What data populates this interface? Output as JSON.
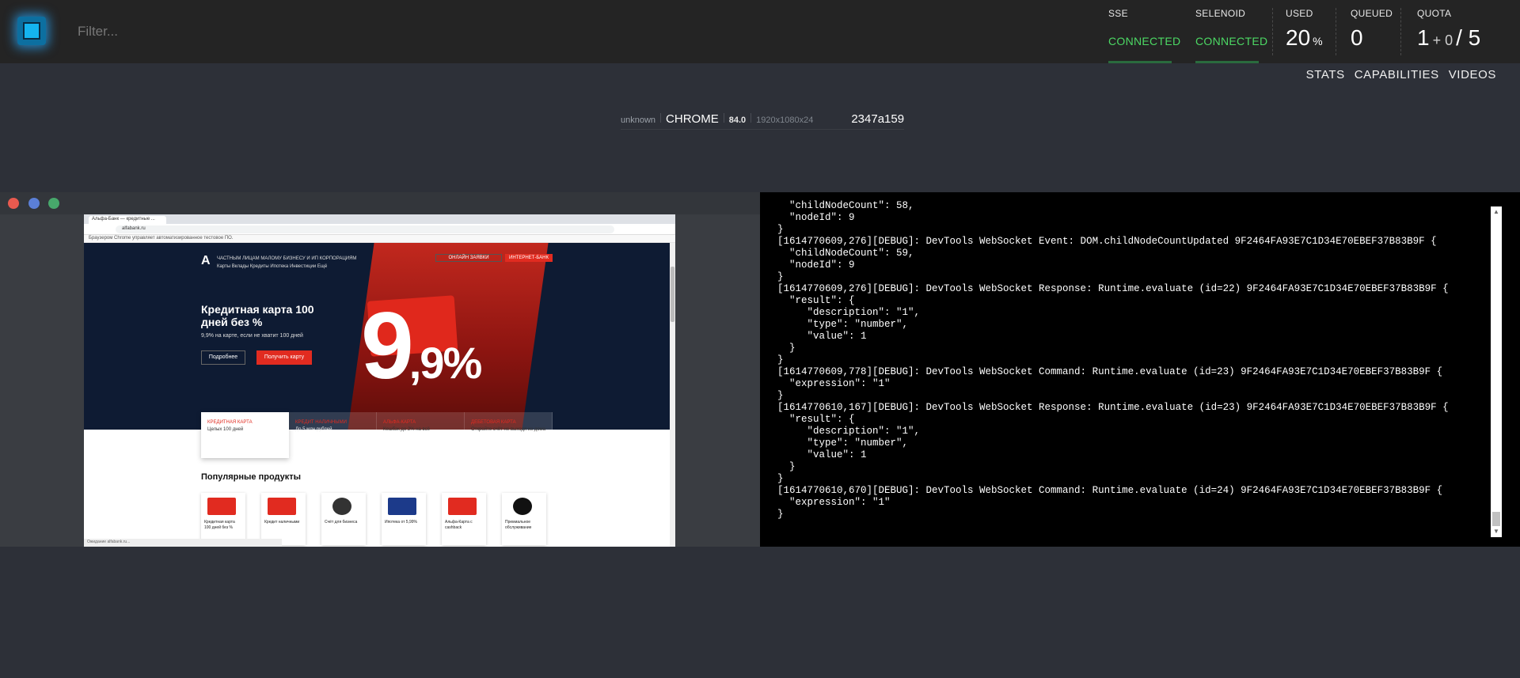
{
  "header": {
    "filter_placeholder": "Filter...",
    "stats": {
      "sse": {
        "label": "SSE",
        "status": "CONNECTED"
      },
      "selenoid": {
        "label": "SELENOID",
        "status": "CONNECTED"
      },
      "used": {
        "label": "USED",
        "value": "20",
        "unit": "%"
      },
      "queued": {
        "label": "QUEUED",
        "value": "0"
      },
      "quota": {
        "label": "QUOTA",
        "value_used": "1",
        "plus": "+ 0",
        "slash": "/",
        "value_total": "5"
      }
    },
    "colors": {
      "connected": "#4cd964",
      "accent": "#14b4f0"
    }
  },
  "nav": {
    "stats": "STATS",
    "capabilities": "CAPABILITIES",
    "videos": "VIDEOS"
  },
  "session": {
    "platform": "unknown",
    "browser": "CHROME",
    "version": "84.0",
    "resolution": "1920x1080x24",
    "id": "2347a159"
  },
  "vnc": {
    "window_dots": [
      "#e85a4f",
      "#5b7fd6",
      "#47a86b"
    ],
    "remote_page": {
      "tab_title": "Альфа-Банк — кредитные ...",
      "url": "alfabank.ru",
      "infobar": "Браузером Chrome управляет автоматизированное тестовое ПО.",
      "brand": "А",
      "menu_top": "ЧАСТНЫМ ЛИЦАМ   МАЛОМУ БИЗНЕСУ И ИП   КОРПОРАЦИЯМ",
      "menu_bottom": "Карты  Вклады  Кредиты  Ипотека  Инвестиции  Ещё",
      "btn_apply": "ОНЛАЙН ЗАЯВКИ",
      "btn_bank": "ИНТЕРНЕТ-БАНК",
      "hero_title": "Кредитная карта 100 дней без %",
      "hero_sub": "9,9% на карте, если не хватит 100 дней",
      "btn_more": "Подробнее",
      "btn_get": "Получить карту",
      "big_number": "9",
      "big_suffix": ",9%",
      "tiles": [
        {
          "title": "КРЕДИТНАЯ КАРТА",
          "text": "Целых 100 дней"
        },
        {
          "title": "КРЕДИТ НАЛИЧНЫМИ",
          "text": "До 5 млн рублей"
        },
        {
          "title": "АЛЬФА-КАРТА",
          "text": "Кешбэк до 2% на всё"
        },
        {
          "title": "ДЕБЕТОВАЯ КАРТА",
          "text": "Откройте счёт не выходя из дома"
        }
      ],
      "popular_title": "Популярные продукты",
      "products": [
        {
          "name": "Кредитная карта 100 дней без %",
          "color": "#e12b20"
        },
        {
          "name": "Кредит наличными",
          "color": "#e12b20"
        },
        {
          "name": "Счёт для бизнеса",
          "color": "#333333"
        },
        {
          "name": "Ипотека от 5,99%",
          "color": "#1c3a8a"
        },
        {
          "name": "Альфа-Карта с cashback",
          "color": "#e12b20"
        },
        {
          "name": "Премиальное обслуживание",
          "color": "#111111"
        }
      ],
      "statusbar": "Ожидание alfabank.ru..."
    }
  },
  "log": {
    "lines": [
      "  \"childNodeCount\": 58,",
      "  \"nodeId\": 9",
      "}",
      "[1614770609,276][DEBUG]: DevTools WebSocket Event: DOM.childNodeCountUpdated 9F2464FA93E7C1D34E70EBEF37B83B9F {",
      "  \"childNodeCount\": 59,",
      "  \"nodeId\": 9",
      "}",
      "[1614770609,276][DEBUG]: DevTools WebSocket Response: Runtime.evaluate (id=22) 9F2464FA93E7C1D34E70EBEF37B83B9F {",
      "  \"result\": {",
      "     \"description\": \"1\",",
      "     \"type\": \"number\",",
      "     \"value\": 1",
      "  }",
      "}",
      "[1614770609,778][DEBUG]: DevTools WebSocket Command: Runtime.evaluate (id=23) 9F2464FA93E7C1D34E70EBEF37B83B9F {",
      "  \"expression\": \"1\"",
      "}",
      "[1614770610,167][DEBUG]: DevTools WebSocket Response: Runtime.evaluate (id=23) 9F2464FA93E7C1D34E70EBEF37B83B9F {",
      "  \"result\": {",
      "     \"description\": \"1\",",
      "     \"type\": \"number\",",
      "     \"value\": 1",
      "  }",
      "}",
      "[1614770610,670][DEBUG]: DevTools WebSocket Command: Runtime.evaluate (id=24) 9F2464FA93E7C1D34E70EBEF37B83B9F {",
      "  \"expression\": \"1\"",
      "}"
    ]
  }
}
